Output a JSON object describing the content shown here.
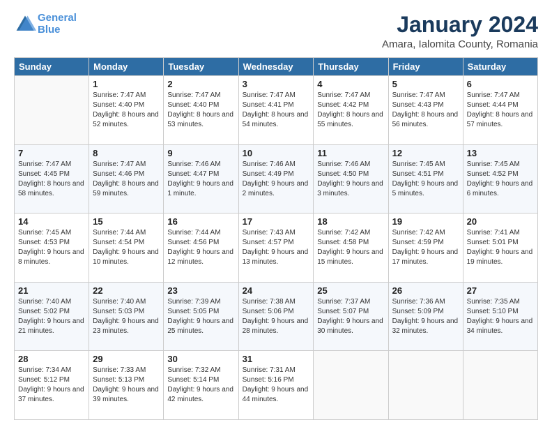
{
  "logo": {
    "line1": "General",
    "line2": "Blue"
  },
  "title": "January 2024",
  "subtitle": "Amara, Ialomita County, Romania",
  "days_of_week": [
    "Sunday",
    "Monday",
    "Tuesday",
    "Wednesday",
    "Thursday",
    "Friday",
    "Saturday"
  ],
  "weeks": [
    [
      {
        "num": "",
        "sunrise": "",
        "sunset": "",
        "daylight": ""
      },
      {
        "num": "1",
        "sunrise": "Sunrise: 7:47 AM",
        "sunset": "Sunset: 4:40 PM",
        "daylight": "Daylight: 8 hours and 52 minutes."
      },
      {
        "num": "2",
        "sunrise": "Sunrise: 7:47 AM",
        "sunset": "Sunset: 4:40 PM",
        "daylight": "Daylight: 8 hours and 53 minutes."
      },
      {
        "num": "3",
        "sunrise": "Sunrise: 7:47 AM",
        "sunset": "Sunset: 4:41 PM",
        "daylight": "Daylight: 8 hours and 54 minutes."
      },
      {
        "num": "4",
        "sunrise": "Sunrise: 7:47 AM",
        "sunset": "Sunset: 4:42 PM",
        "daylight": "Daylight: 8 hours and 55 minutes."
      },
      {
        "num": "5",
        "sunrise": "Sunrise: 7:47 AM",
        "sunset": "Sunset: 4:43 PM",
        "daylight": "Daylight: 8 hours and 56 minutes."
      },
      {
        "num": "6",
        "sunrise": "Sunrise: 7:47 AM",
        "sunset": "Sunset: 4:44 PM",
        "daylight": "Daylight: 8 hours and 57 minutes."
      }
    ],
    [
      {
        "num": "7",
        "sunrise": "Sunrise: 7:47 AM",
        "sunset": "Sunset: 4:45 PM",
        "daylight": "Daylight: 8 hours and 58 minutes."
      },
      {
        "num": "8",
        "sunrise": "Sunrise: 7:47 AM",
        "sunset": "Sunset: 4:46 PM",
        "daylight": "Daylight: 8 hours and 59 minutes."
      },
      {
        "num": "9",
        "sunrise": "Sunrise: 7:46 AM",
        "sunset": "Sunset: 4:47 PM",
        "daylight": "Daylight: 9 hours and 1 minute."
      },
      {
        "num": "10",
        "sunrise": "Sunrise: 7:46 AM",
        "sunset": "Sunset: 4:49 PM",
        "daylight": "Daylight: 9 hours and 2 minutes."
      },
      {
        "num": "11",
        "sunrise": "Sunrise: 7:46 AM",
        "sunset": "Sunset: 4:50 PM",
        "daylight": "Daylight: 9 hours and 3 minutes."
      },
      {
        "num": "12",
        "sunrise": "Sunrise: 7:45 AM",
        "sunset": "Sunset: 4:51 PM",
        "daylight": "Daylight: 9 hours and 5 minutes."
      },
      {
        "num": "13",
        "sunrise": "Sunrise: 7:45 AM",
        "sunset": "Sunset: 4:52 PM",
        "daylight": "Daylight: 9 hours and 6 minutes."
      }
    ],
    [
      {
        "num": "14",
        "sunrise": "Sunrise: 7:45 AM",
        "sunset": "Sunset: 4:53 PM",
        "daylight": "Daylight: 9 hours and 8 minutes."
      },
      {
        "num": "15",
        "sunrise": "Sunrise: 7:44 AM",
        "sunset": "Sunset: 4:54 PM",
        "daylight": "Daylight: 9 hours and 10 minutes."
      },
      {
        "num": "16",
        "sunrise": "Sunrise: 7:44 AM",
        "sunset": "Sunset: 4:56 PM",
        "daylight": "Daylight: 9 hours and 12 minutes."
      },
      {
        "num": "17",
        "sunrise": "Sunrise: 7:43 AM",
        "sunset": "Sunset: 4:57 PM",
        "daylight": "Daylight: 9 hours and 13 minutes."
      },
      {
        "num": "18",
        "sunrise": "Sunrise: 7:42 AM",
        "sunset": "Sunset: 4:58 PM",
        "daylight": "Daylight: 9 hours and 15 minutes."
      },
      {
        "num": "19",
        "sunrise": "Sunrise: 7:42 AM",
        "sunset": "Sunset: 4:59 PM",
        "daylight": "Daylight: 9 hours and 17 minutes."
      },
      {
        "num": "20",
        "sunrise": "Sunrise: 7:41 AM",
        "sunset": "Sunset: 5:01 PM",
        "daylight": "Daylight: 9 hours and 19 minutes."
      }
    ],
    [
      {
        "num": "21",
        "sunrise": "Sunrise: 7:40 AM",
        "sunset": "Sunset: 5:02 PM",
        "daylight": "Daylight: 9 hours and 21 minutes."
      },
      {
        "num": "22",
        "sunrise": "Sunrise: 7:40 AM",
        "sunset": "Sunset: 5:03 PM",
        "daylight": "Daylight: 9 hours and 23 minutes."
      },
      {
        "num": "23",
        "sunrise": "Sunrise: 7:39 AM",
        "sunset": "Sunset: 5:05 PM",
        "daylight": "Daylight: 9 hours and 25 minutes."
      },
      {
        "num": "24",
        "sunrise": "Sunrise: 7:38 AM",
        "sunset": "Sunset: 5:06 PM",
        "daylight": "Daylight: 9 hours and 28 minutes."
      },
      {
        "num": "25",
        "sunrise": "Sunrise: 7:37 AM",
        "sunset": "Sunset: 5:07 PM",
        "daylight": "Daylight: 9 hours and 30 minutes."
      },
      {
        "num": "26",
        "sunrise": "Sunrise: 7:36 AM",
        "sunset": "Sunset: 5:09 PM",
        "daylight": "Daylight: 9 hours and 32 minutes."
      },
      {
        "num": "27",
        "sunrise": "Sunrise: 7:35 AM",
        "sunset": "Sunset: 5:10 PM",
        "daylight": "Daylight: 9 hours and 34 minutes."
      }
    ],
    [
      {
        "num": "28",
        "sunrise": "Sunrise: 7:34 AM",
        "sunset": "Sunset: 5:12 PM",
        "daylight": "Daylight: 9 hours and 37 minutes."
      },
      {
        "num": "29",
        "sunrise": "Sunrise: 7:33 AM",
        "sunset": "Sunset: 5:13 PM",
        "daylight": "Daylight: 9 hours and 39 minutes."
      },
      {
        "num": "30",
        "sunrise": "Sunrise: 7:32 AM",
        "sunset": "Sunset: 5:14 PM",
        "daylight": "Daylight: 9 hours and 42 minutes."
      },
      {
        "num": "31",
        "sunrise": "Sunrise: 7:31 AM",
        "sunset": "Sunset: 5:16 PM",
        "daylight": "Daylight: 9 hours and 44 minutes."
      },
      {
        "num": "",
        "sunrise": "",
        "sunset": "",
        "daylight": ""
      },
      {
        "num": "",
        "sunrise": "",
        "sunset": "",
        "daylight": ""
      },
      {
        "num": "",
        "sunrise": "",
        "sunset": "",
        "daylight": ""
      }
    ]
  ]
}
